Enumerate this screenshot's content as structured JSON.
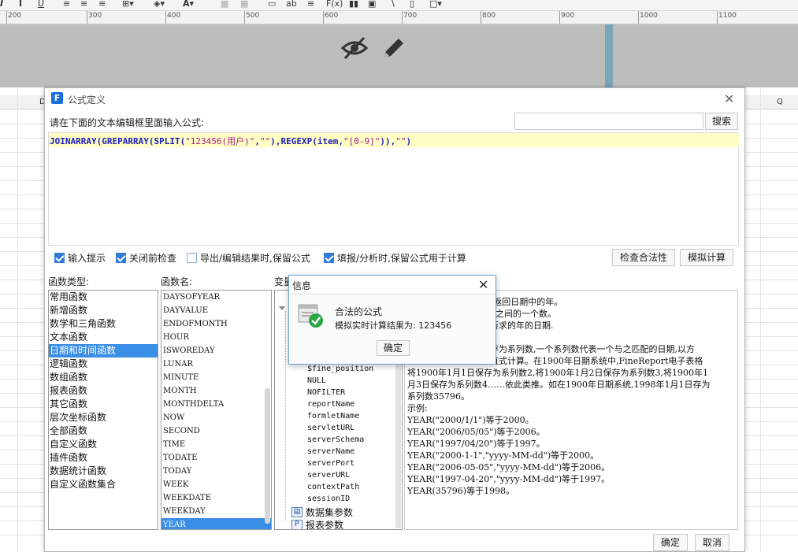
{
  "colors": {
    "accent": "#3a8ee6",
    "formula_func": "#1c1cc6",
    "formula_string": "#a81c8a",
    "editor_highlight": "#fdfdc4"
  },
  "ruler": {
    "labels": [
      "200",
      "300",
      "400",
      "500",
      "600",
      "700",
      "800",
      "900",
      "1000",
      "1100"
    ]
  },
  "sheet": {
    "col_labels": [
      "D",
      "Q"
    ]
  },
  "dialog": {
    "title": "公式定义",
    "prompt": "请在下面的文本编辑框里面输入公式:",
    "search_placeholder": "",
    "search_button": "搜索",
    "formula": {
      "parts": [
        {
          "text": "JOINARRAY(GREPARRAY(SPLIT(",
          "kind": "func"
        },
        {
          "text": "\"123456(用户)\"",
          "kind": "str"
        },
        {
          "text": ",",
          "kind": "func"
        },
        {
          "text": "\"\"",
          "kind": "str"
        },
        {
          "text": "),REGEXP(item,",
          "kind": "func"
        },
        {
          "text": "\"[0-9]\"",
          "kind": "str"
        },
        {
          "text": ")),",
          "kind": "func"
        },
        {
          "text": "\"\"",
          "kind": "str"
        },
        {
          "text": ")",
          "kind": "func"
        }
      ]
    },
    "options": {
      "input_hint": "输入提示",
      "close_check": "关闭前检查",
      "export_keep": "导出/编辑结果时,保留公式",
      "fill_keep": "填报/分析时,保留公式用于计算"
    },
    "check_button": "检查合法性",
    "simulate_button": "模拟计算",
    "func_type_label": "函数类型:",
    "func_name_label": "函数名:",
    "var_label": "变量",
    "func_types": [
      "常用函数",
      "新增函数",
      "数学和三角函数",
      "文本函数",
      "日期和时间函数",
      "逻辑函数",
      "数组函数",
      "报表函数",
      "其它函数",
      "层次坐标函数",
      "全部函数",
      "自定义函数",
      "插件函数",
      "数据统计函数",
      "自定义函数集合"
    ],
    "func_type_selected": 4,
    "func_names": [
      "DAYSOFYEAR",
      "DAYVALUE",
      "ENDOFMONTH",
      "HOUR",
      "ISWOREDAY",
      "LUNAR",
      "MINUTE",
      "MONTH",
      "MONTHDELTA",
      "NOW",
      "SECOND",
      "TIME",
      "TODATE",
      "TODAY",
      "WEEK",
      "WEEKDATE",
      "WEEKDAY",
      "YEAR"
    ],
    "func_name_selected": 17,
    "variables": [
      "$fine_position",
      "NULL",
      "NOFILTER",
      "reportName",
      "formletName",
      "servletURL",
      "serverSchema",
      "serverName",
      "serverPort",
      "serverURL",
      "contextPath",
      "sessionID"
    ],
    "var_groups": [
      {
        "label": "数据集参数",
        "icon": "db-param-icon",
        "glyph": "▤"
      },
      {
        "label": "报表参数",
        "icon": "report-param-icon",
        "glyph": "P"
      }
    ],
    "description": [
      ")返回日期中的年。",
      "9之间的一个数。",
      "所求的年的日期.",
      "",
      "存为系列数,一个系列数代表一个与之匹配的日期,以方",
      "直式计算。在1900年日期系统中,FineReport电子表格",
      "将1900年1月1日保存为系列数2,将1900年1月2日保存为系列数3,将1900年1",
      "月3日保存为系列数4……依此类推。如在1900年日期系统,1998年1月1日存为",
      "系列数35796。",
      "示例:",
      "YEAR(\"2000/1/1\")等于2000。",
      "YEAR(\"2006/05/05\")等于2006。",
      "YEAR(\"1997/04/20\")等于1997。",
      "YEAR(\"2000-1-1\",\"yyyy-MM-dd\")等于2000。",
      "YEAR(\"2006-05-05\",\"yyyy-MM-dd\")等于2006。",
      "YEAR(\"1997-04-20\",\"yyyy-MM-dd\")等于1997。",
      "YEAR(35796)等于1998。"
    ],
    "ok_button": "确定",
    "cancel_button": "取消"
  },
  "info_dialog": {
    "title": "信息",
    "message": "合法的公式",
    "result": "模拟实时计算结果为: 123456",
    "ok_button": "确定"
  }
}
